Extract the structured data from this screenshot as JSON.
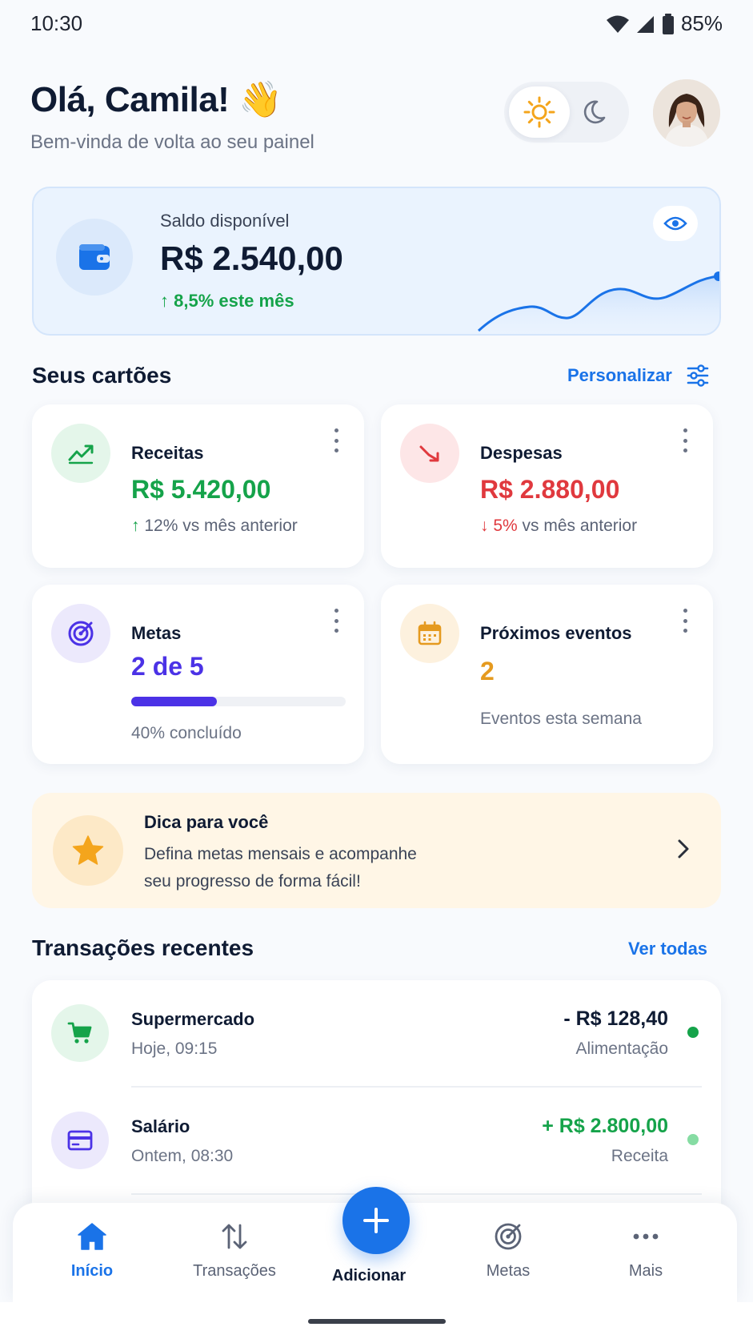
{
  "status": {
    "time": "10:30",
    "battery": "85%"
  },
  "header": {
    "greeting": "Olá, Camila! 👋",
    "subtitle": "Bem-vinda de volta ao seu painel"
  },
  "balance": {
    "label": "Saldo disponível",
    "value": "R$ 2.540,00",
    "trend": "8,5% este mês"
  },
  "cards_section": {
    "title": "Seus cartões",
    "action": "Personalizar"
  },
  "cards": {
    "receitas": {
      "title": "Receitas",
      "value": "R$ 5.420,00",
      "note": "12% vs mês anterior"
    },
    "despesas": {
      "title": "Despesas",
      "value": "R$ 2.880,00",
      "note_pct": "5%",
      "note_rest": " vs mês anterior"
    },
    "metas": {
      "title": "Metas",
      "value": "2 de 5",
      "progress": 0.4,
      "note": "40% concluído"
    },
    "eventos": {
      "title": "Próximos eventos",
      "value": "2",
      "note": "Eventos esta semana"
    }
  },
  "tip": {
    "title": "Dica para você",
    "line1": "Defina metas mensais e acompanhe",
    "line2": "seu progresso de forma fácil!"
  },
  "transactions_section": {
    "title": "Transações recentes",
    "action": "Ver todas"
  },
  "transactions": [
    {
      "name": "Supermercado",
      "date": "Hoje, 09:15",
      "amount": "- R$ 128,40",
      "category": "Alimentação"
    },
    {
      "name": "Salário",
      "date": "Ontem, 08:30",
      "amount": "+ R$ 2.800,00",
      "category": "Receita"
    }
  ],
  "nav": {
    "home": "Início",
    "transactions": "Transações",
    "add": "Adicionar",
    "goals": "Metas",
    "more": "Mais"
  },
  "colors": {
    "accent": "#1a73e8",
    "income": "#15a34a",
    "expense": "#e0393e",
    "goals": "#4b32e6",
    "events": "#e59a1f"
  }
}
